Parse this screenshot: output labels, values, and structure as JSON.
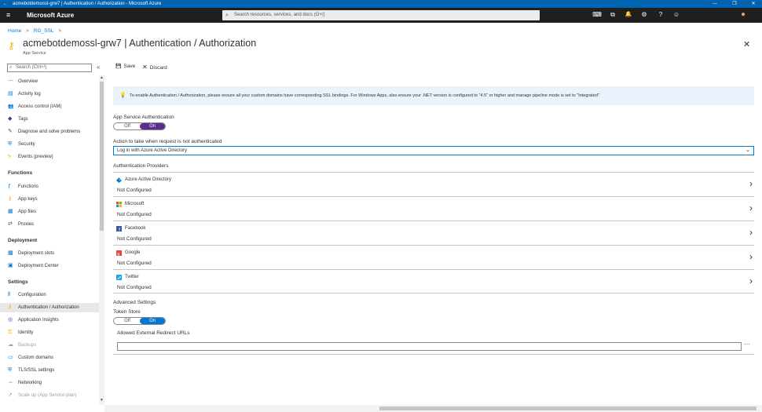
{
  "window": {
    "title": "acmebotdemossl-grw7 | Authentication / Authorization - Microsoft Azure",
    "back_icon": "←",
    "minimize": "—",
    "restore": "❐",
    "close": "✕"
  },
  "topbar": {
    "menu_icon": "≡",
    "brand": "Microsoft Azure",
    "search_placeholder": "Search resources, services, and docs (G+/)",
    "icons": {
      "cloud_shell": "⌨",
      "directory": "⧉",
      "notifications": "🔔",
      "settings": "⚙",
      "help": "?",
      "feedback": "☺",
      "avatar": "●"
    }
  },
  "breadcrumb": {
    "home": "Home",
    "sep1": ">",
    "rg": "RG_SSL",
    "sep2": ">"
  },
  "page": {
    "title": "acmebotdemossl-grw7 | Authentication / Authorization",
    "subtitle": "App Service",
    "close": "✕"
  },
  "sidebar": {
    "search_placeholder": "Search (Ctrl+/)",
    "collapse_icon": "«",
    "items_top": [
      {
        "icon": "⋯",
        "label": "Overview"
      },
      {
        "icon": "▤",
        "label": "Activity log"
      },
      {
        "icon": "👥",
        "label": "Access control (IAM)"
      },
      {
        "icon": "◆",
        "label": "Tags"
      },
      {
        "icon": "✎",
        "label": "Diagnose and solve problems"
      },
      {
        "icon": "⛨",
        "label": "Security"
      },
      {
        "icon": "ϟ",
        "label": "Events (preview)"
      }
    ],
    "group_functions": "Functions",
    "items_functions": [
      {
        "icon": "ƒ",
        "label": "Functions"
      },
      {
        "icon": "⚷",
        "label": "App keys"
      },
      {
        "icon": "▦",
        "label": "App files"
      },
      {
        "icon": "⇄",
        "label": "Proxies"
      }
    ],
    "group_deployment": "Deployment",
    "items_deployment": [
      {
        "icon": "▩",
        "label": "Deployment slots"
      },
      {
        "icon": "▣",
        "label": "Deployment Center"
      }
    ],
    "group_settings": "Settings",
    "items_settings": [
      {
        "icon": "⦀",
        "label": "Configuration"
      },
      {
        "icon": "⚷",
        "label": "Authentication / Authorization"
      },
      {
        "icon": "◎",
        "label": "Application Insights"
      },
      {
        "icon": "⚿",
        "label": "Identity"
      },
      {
        "icon": "☁",
        "label": "Backups"
      },
      {
        "icon": "▭",
        "label": "Custom domains"
      },
      {
        "icon": "⛨",
        "label": "TLS/SSL settings"
      },
      {
        "icon": "⇔",
        "label": "Networking"
      },
      {
        "icon": "↗",
        "label": "Scale up (App Service plan)"
      }
    ]
  },
  "toolbar": {
    "save": "Save",
    "save_icon": "💾",
    "discard": "Discard",
    "discard_icon": "✕"
  },
  "notice": {
    "icon": "💡",
    "text": "To enable Authentication / Authorization, please ensure all your custom domains have corresponding SSL bindings. For Windows Apps, also ensure your .NET version is configured to \"4.5\" or higher and manage pipeline mode is set to \"Integrated\""
  },
  "app_auth": {
    "label": "App Service Authentication",
    "off": "Off",
    "on": "On",
    "selected": "On"
  },
  "action": {
    "label": "Action to take when request is not authenticated",
    "value": "Log in with Azure Active Directory",
    "chevron": "⌄"
  },
  "providers": {
    "header": "Authentication Providers",
    "items": [
      {
        "name": "Azure Active Directory",
        "status": "Not Configured",
        "icon": "aad-icon"
      },
      {
        "name": "Microsoft",
        "status": "Not Configured",
        "icon": "microsoft-icon"
      },
      {
        "name": "Facebook",
        "status": "Not Configured",
        "icon": "facebook-icon"
      },
      {
        "name": "Google",
        "status": "Not Configured",
        "icon": "google-icon"
      },
      {
        "name": "Twitter",
        "status": "Not Configured",
        "icon": "twitter-icon"
      }
    ],
    "chevron": "›"
  },
  "advanced": {
    "header": "Advanced Settings",
    "token_label": "Token Store",
    "off": "Off",
    "on": "On",
    "selected": "On",
    "redirect_label": "Allowed External Redirect URLs",
    "redirect_value": "",
    "more": "···"
  },
  "colors": {
    "accent": "#0078d4",
    "toggle_on_purple": "#5c2d91",
    "toggle_on_blue": "#0078d4",
    "titlebar": "#0063b1",
    "topbar": "#1f1f1f"
  }
}
